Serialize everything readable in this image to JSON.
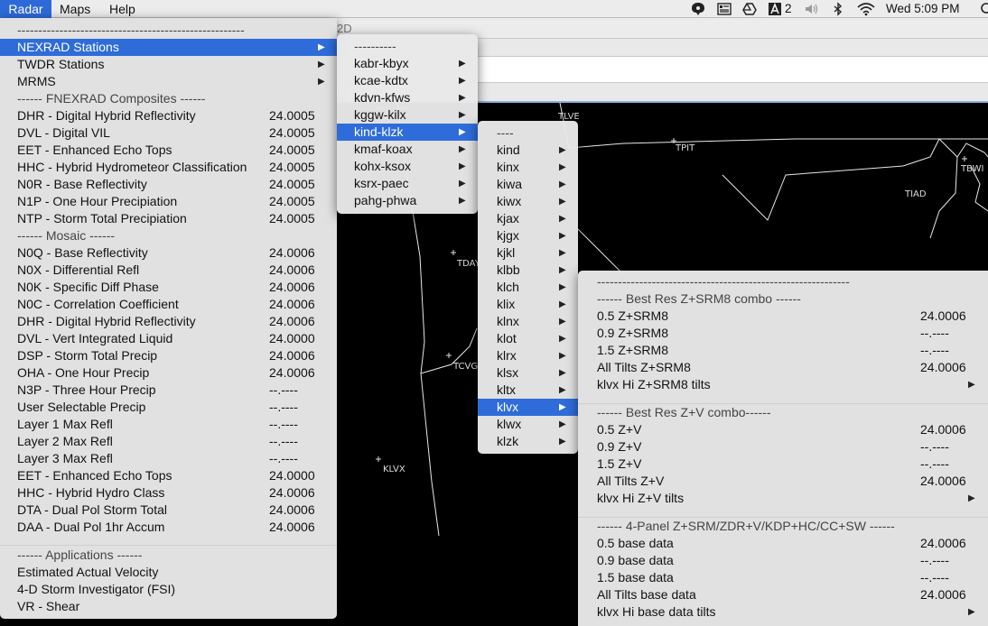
{
  "menubar": {
    "items": [
      "Radar",
      "Maps",
      "Help"
    ],
    "status": {
      "badge_count": "2",
      "clock": "Wed 5:09 PM"
    }
  },
  "window": {
    "title_fragment": "2D"
  },
  "map": {
    "labels": [
      "TLVE",
      "TPIT",
      "TBWI",
      "TIAD",
      "TDAY",
      "TCVG",
      "KLVX"
    ]
  },
  "radar_menu": {
    "items": [
      {
        "label": "------------------------------------------------------",
        "type": "header"
      },
      {
        "label": "NEXRAD Stations",
        "submenu": true,
        "selected": true
      },
      {
        "label": "TWDR Stations",
        "submenu": true
      },
      {
        "label": "MRMS",
        "submenu": true
      },
      {
        "label": "------ FNEXRAD Composites ------",
        "type": "header"
      },
      {
        "label": "DHR - Digital Hybrid Reflectivity",
        "value": "24.0005"
      },
      {
        "label": "DVL - Digital VIL",
        "value": "24.0005"
      },
      {
        "label": "EET - Enhanced Echo Tops",
        "value": "24.0005"
      },
      {
        "label": "HHC - Hybrid Hydrometeor Classification",
        "value": "24.0005"
      },
      {
        "label": "N0R - Base Reflectivity",
        "value": "24.0005"
      },
      {
        "label": "N1P - One Hour Precipiation",
        "value": "24.0005"
      },
      {
        "label": "NTP - Storm Total Precipiation",
        "value": "24.0005"
      },
      {
        "label": "------ Mosaic ------",
        "type": "header"
      },
      {
        "label": "N0Q - Base Reflectivity",
        "value": "24.0006"
      },
      {
        "label": "N0X - Differential Refl",
        "value": "24.0006"
      },
      {
        "label": "N0K - Specific Diff Phase",
        "value": "24.0006"
      },
      {
        "label": "N0C - Correlation Coefficient",
        "value": "24.0006"
      },
      {
        "label": "DHR - Digital Hybrid Reflectivity",
        "value": "24.0006"
      },
      {
        "label": "DVL - Vert Integrated Liquid",
        "value": "24.0000"
      },
      {
        "label": "DSP - Storm Total Precip",
        "value": "24.0006"
      },
      {
        "label": "OHA - One Hour Precip",
        "value": "24.0006"
      },
      {
        "label": "N3P - Three Hour Precip",
        "value": "--.----"
      },
      {
        "label": "User Selectable Precip",
        "value": "--.----"
      },
      {
        "label": "Layer 1 Max Refl",
        "value": "--.----"
      },
      {
        "label": "Layer 2 Max Refl",
        "value": "--.----"
      },
      {
        "label": "Layer 3 Max Refl",
        "value": "--.----"
      },
      {
        "label": "EET - Enhanced Echo Tops",
        "value": "24.0000"
      },
      {
        "label": "HHC - Hybrid Hydro Class",
        "value": "24.0006"
      },
      {
        "label": "DTA - Dual Pol Storm Total",
        "value": "24.0006"
      },
      {
        "label": "DAA - Dual Pol 1hr Accum",
        "value": "24.0006"
      },
      {
        "type": "separator"
      },
      {
        "label": "------ Applications ------",
        "type": "header"
      },
      {
        "label": "Estimated Actual Velocity"
      },
      {
        "label": "4-D Storm Investigator (FSI)"
      },
      {
        "label": "VR - Shear"
      }
    ]
  },
  "nexrad_menu": {
    "items": [
      {
        "label": "----------",
        "type": "header"
      },
      {
        "label": "kabr-kbyx",
        "submenu": true
      },
      {
        "label": "kcae-kdtx",
        "submenu": true
      },
      {
        "label": "kdvn-kfws",
        "submenu": true
      },
      {
        "label": "kggw-kilx",
        "submenu": true
      },
      {
        "label": "kind-klzk",
        "submenu": true,
        "selected": true
      },
      {
        "label": "kmaf-koax",
        "submenu": true
      },
      {
        "label": "kohx-ksox",
        "submenu": true
      },
      {
        "label": "ksrx-paec",
        "submenu": true
      },
      {
        "label": "pahg-phwa",
        "submenu": true
      }
    ]
  },
  "station_menu": {
    "items": [
      {
        "label": "----",
        "type": "header"
      },
      {
        "label": "kind",
        "submenu": true
      },
      {
        "label": "kinx",
        "submenu": true
      },
      {
        "label": "kiwa",
        "submenu": true
      },
      {
        "label": "kiwx",
        "submenu": true
      },
      {
        "label": "kjax",
        "submenu": true
      },
      {
        "label": "kjgx",
        "submenu": true
      },
      {
        "label": "kjkl",
        "submenu": true
      },
      {
        "label": "klbb",
        "submenu": true
      },
      {
        "label": "klch",
        "submenu": true
      },
      {
        "label": "klix",
        "submenu": true
      },
      {
        "label": "klnx",
        "submenu": true
      },
      {
        "label": "klot",
        "submenu": true
      },
      {
        "label": "klrx",
        "submenu": true
      },
      {
        "label": "klsx",
        "submenu": true
      },
      {
        "label": "kltx",
        "submenu": true
      },
      {
        "label": "klvx",
        "submenu": true,
        "selected": true
      },
      {
        "label": "klwx",
        "submenu": true
      },
      {
        "label": "klzk",
        "submenu": true
      }
    ]
  },
  "klvx_menu": {
    "items": [
      {
        "label": "------------------------------------------------------------",
        "type": "header"
      },
      {
        "label": "------ Best Res Z+SRM8 combo ------",
        "type": "header"
      },
      {
        "label": "0.5 Z+SRM8",
        "value": "24.0006"
      },
      {
        "label": "0.9 Z+SRM8",
        "value": "--.----"
      },
      {
        "label": "1.5 Z+SRM8",
        "value": "--.----"
      },
      {
        "label": "All Tilts Z+SRM8",
        "value": "24.0006"
      },
      {
        "label": "klvx Hi Z+SRM8 tilts",
        "submenu": true
      },
      {
        "type": "separator"
      },
      {
        "label": "------ Best Res Z+V combo------",
        "type": "header"
      },
      {
        "label": "0.5 Z+V",
        "value": "24.0006"
      },
      {
        "label": "0.9 Z+V",
        "value": "--.----"
      },
      {
        "label": "1.5 Z+V",
        "value": "--.----"
      },
      {
        "label": "All Tilts Z+V",
        "value": "24.0006"
      },
      {
        "label": "klvx Hi Z+V tilts",
        "submenu": true
      },
      {
        "type": "separator"
      },
      {
        "label": "------ 4-Panel Z+SRM/ZDR+V/KDP+HC/CC+SW ------",
        "type": "header"
      },
      {
        "label": "0.5 base data",
        "value": "24.0006"
      },
      {
        "label": "0.9 base data",
        "value": "--.----"
      },
      {
        "label": "1.5 base data",
        "value": "--.----"
      },
      {
        "label": "All Tilts base data",
        "value": "24.0006"
      },
      {
        "label": "klvx Hi base data tilts",
        "submenu": true
      }
    ]
  }
}
